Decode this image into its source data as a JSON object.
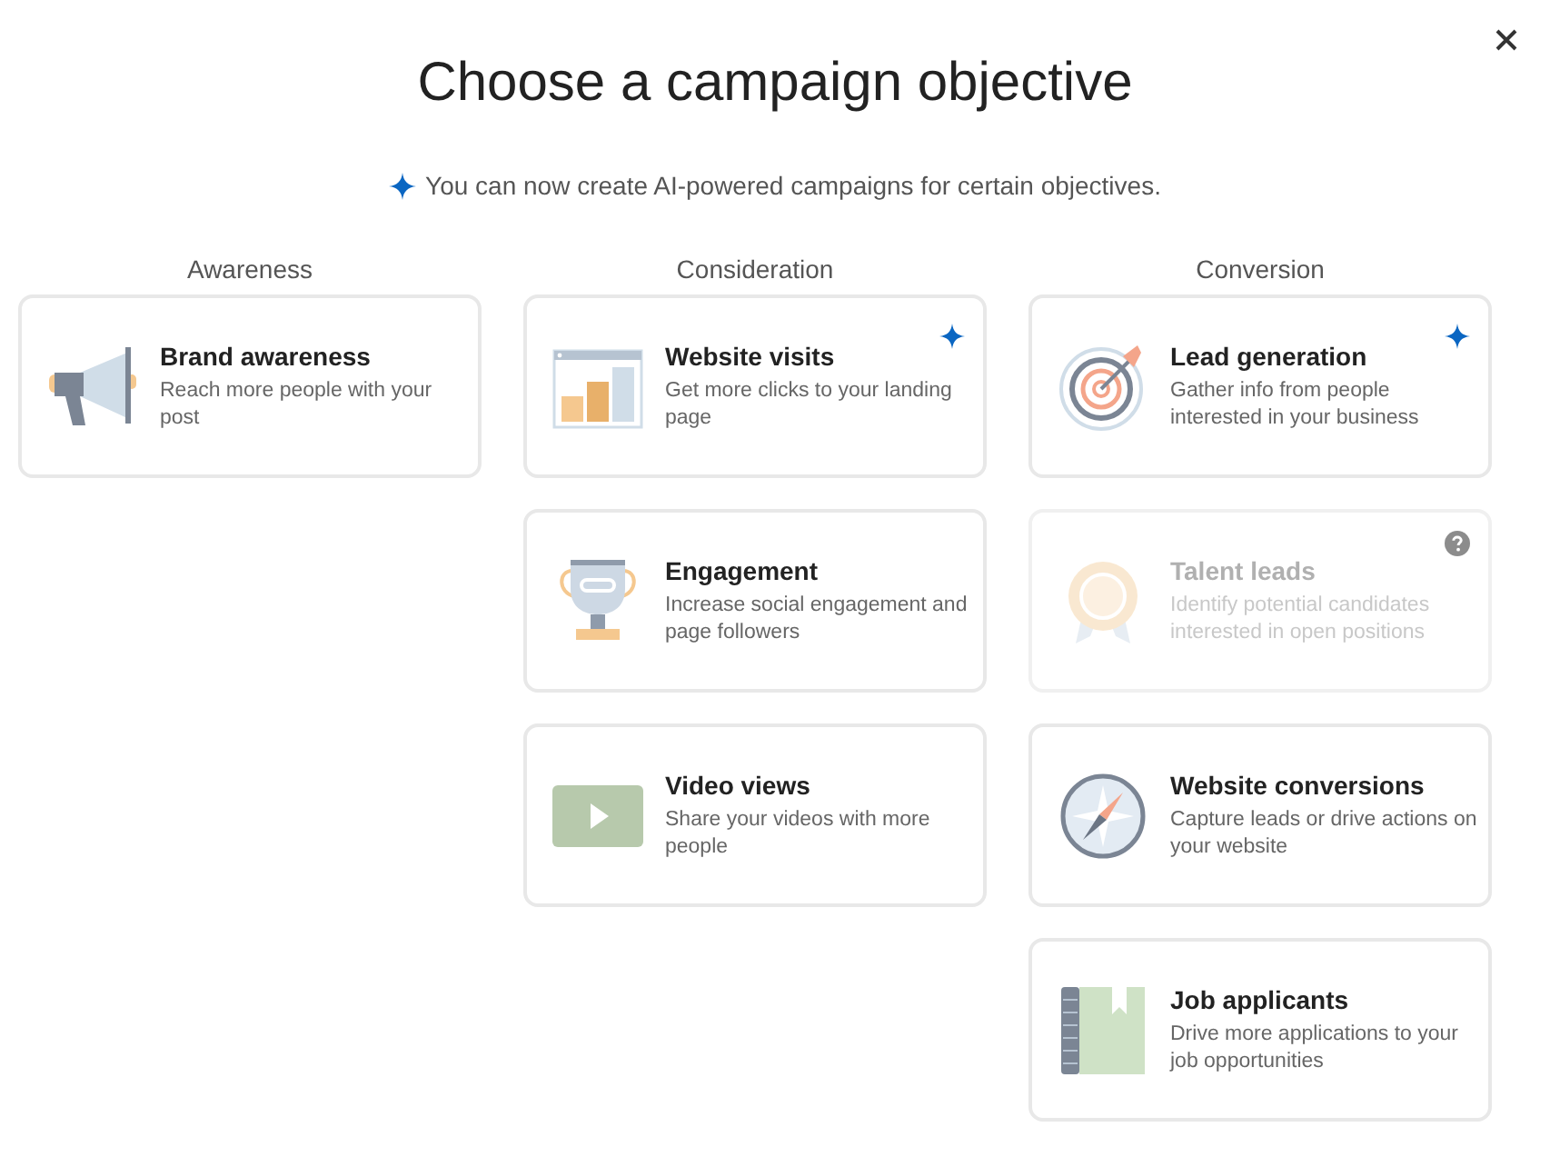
{
  "title": "Choose a campaign objective",
  "notice": "You can now create AI-powered campaigns for certain objectives.",
  "columns": [
    {
      "heading": "Awareness",
      "cards": [
        {
          "kind": "megaphone",
          "title": "Brand awareness",
          "description": "Reach more people with your post",
          "ai": false,
          "disabled": false,
          "help": false
        }
      ]
    },
    {
      "heading": "Consideration",
      "cards": [
        {
          "kind": "chart",
          "title": "Website visits",
          "description": "Get more clicks to your landing page",
          "ai": true,
          "disabled": false,
          "help": false
        },
        {
          "kind": "trophy",
          "title": "Engagement",
          "description": "Increase social engagement and page followers",
          "ai": false,
          "disabled": false,
          "help": false
        },
        {
          "kind": "video",
          "title": "Video views",
          "description": "Share your videos with more people",
          "ai": false,
          "disabled": false,
          "help": false
        }
      ]
    },
    {
      "heading": "Conversion",
      "cards": [
        {
          "kind": "target",
          "title": "Lead generation",
          "description": "Gather info from people interested in your business",
          "ai": true,
          "disabled": false,
          "help": false
        },
        {
          "kind": "badge",
          "title": "Talent leads",
          "description": "Identify potential candidates interested in open positions",
          "ai": false,
          "disabled": true,
          "help": true
        },
        {
          "kind": "compass",
          "title": "Website conversions",
          "description": "Capture leads or drive actions on your website",
          "ai": false,
          "disabled": false,
          "help": false
        },
        {
          "kind": "notebook",
          "title": "Job applicants",
          "description": "Drive more applications to your job opportunities",
          "ai": false,
          "disabled": false,
          "help": false
        }
      ]
    }
  ]
}
